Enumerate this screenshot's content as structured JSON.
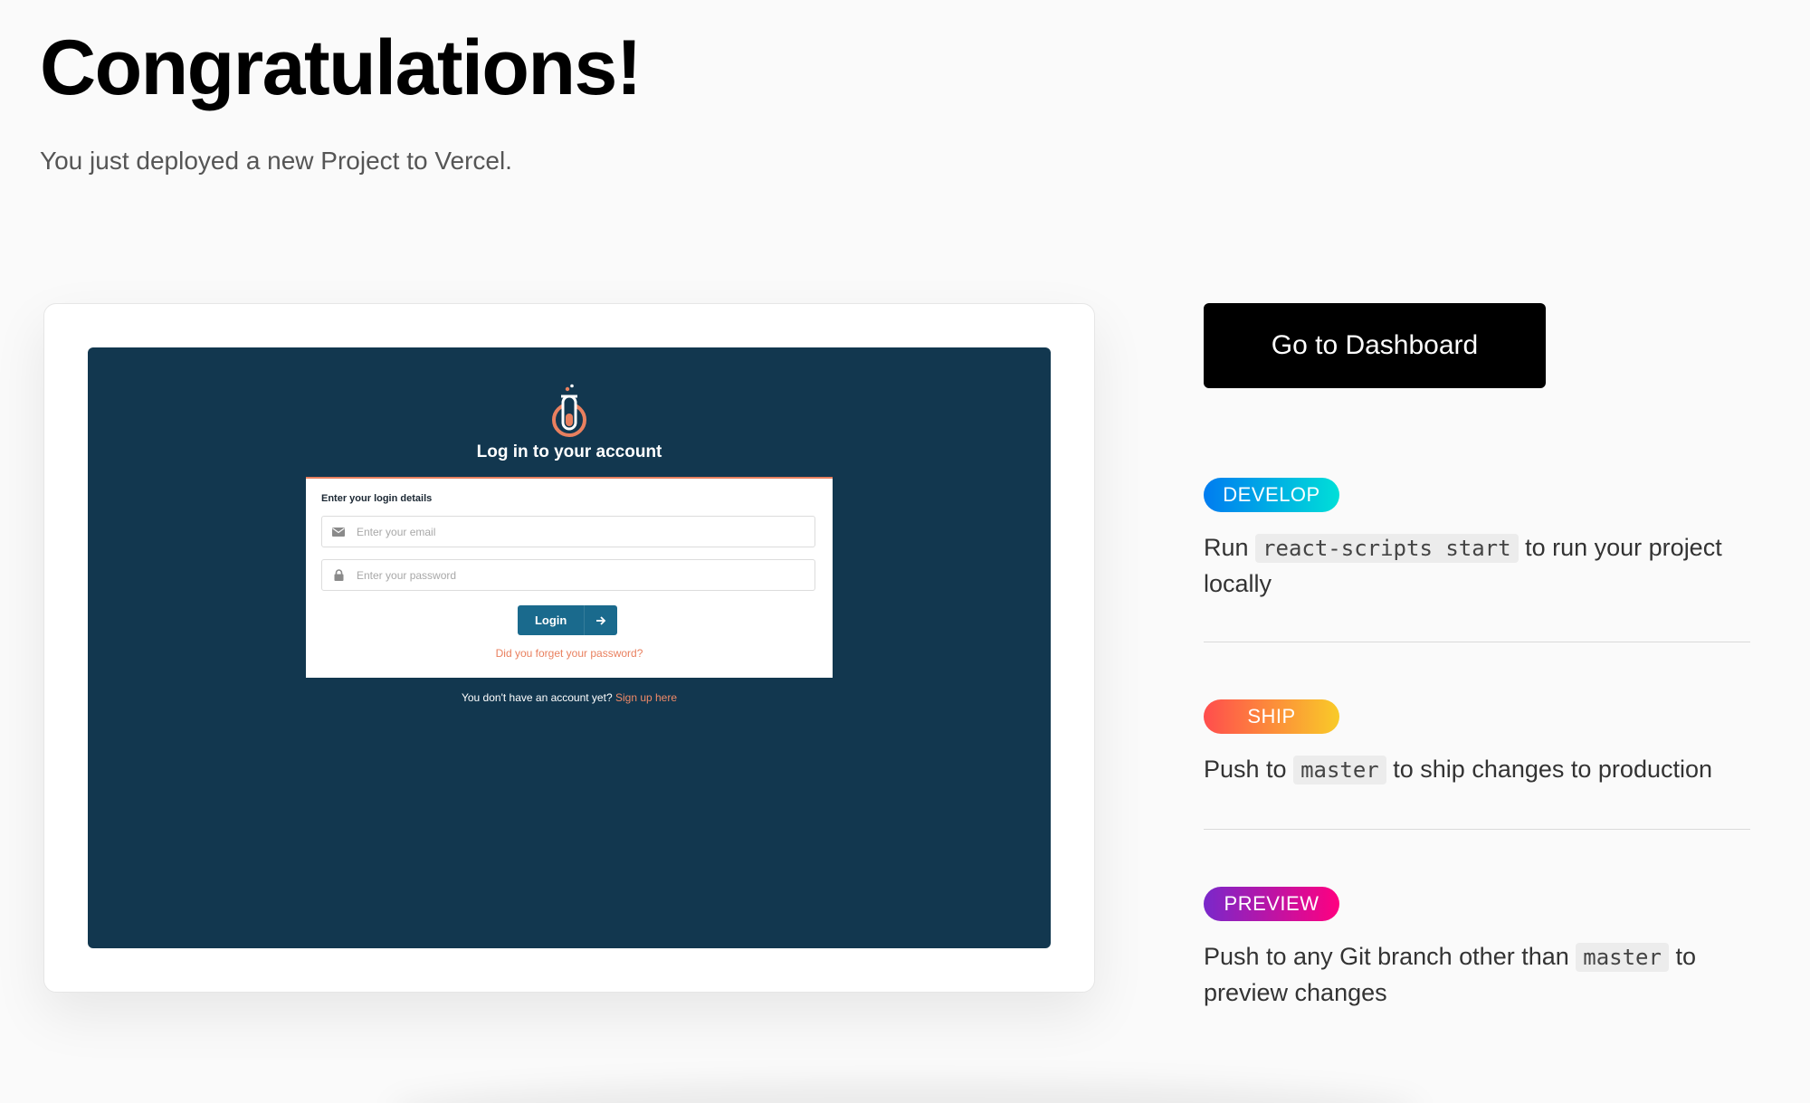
{
  "header": {
    "title": "Congratulations!",
    "subtitle": "You just deployed a new Project to Vercel."
  },
  "preview": {
    "heading": "Log in to your account",
    "form_label": "Enter your login details",
    "email_placeholder": "Enter your email",
    "password_placeholder": "Enter your password",
    "login_label": "Login",
    "forgot_link": "Did you forget your password?",
    "signup_text": "You don't have an account yet?",
    "signup_link": "Sign up here",
    "icons": [
      "flask-logo-icon",
      "envelope-icon",
      "lock-icon",
      "arrow-right-icon"
    ],
    "colors": {
      "background": "#12374f",
      "accent": "#e9805f",
      "button": "#1a6a8d"
    }
  },
  "dashboard_button": "Go to Dashboard",
  "steps": [
    {
      "badge": "DEVELOP",
      "before": "Run ",
      "code": "react-scripts start",
      "after": " to run your project locally"
    },
    {
      "badge": "SHIP",
      "before": "Push to ",
      "code": "master",
      "after": " to ship changes to production"
    },
    {
      "badge": "PREVIEW",
      "before": "Push to any Git branch other than ",
      "code": "master",
      "after": " to preview changes"
    }
  ]
}
